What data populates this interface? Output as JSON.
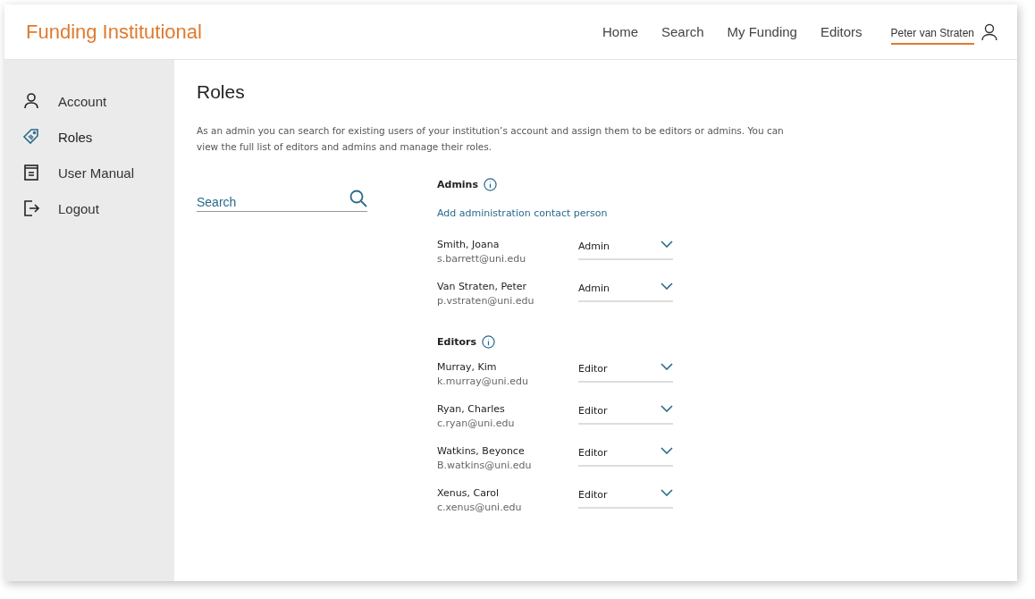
{
  "header": {
    "brand": "Funding Institutional",
    "nav": [
      "Home",
      "Search",
      "My Funding",
      "Editors"
    ],
    "user": "Peter van Straten"
  },
  "sidebar": {
    "items": [
      {
        "label": "Account",
        "kind": "person",
        "selected": false
      },
      {
        "label": "Roles",
        "kind": "tag",
        "selected": true
      },
      {
        "label": "User Manual",
        "kind": "book",
        "selected": false
      },
      {
        "label": "Logout",
        "kind": "logout",
        "selected": false
      }
    ]
  },
  "page": {
    "title": "Roles",
    "description": "As an admin you can search for existing users of your institution’s account and assign them to be editors or admins. You can view the full list of editors and admins and manage their roles.",
    "search": {
      "placeholder": "Search"
    }
  },
  "groups": [
    {
      "title": "Admins",
      "link": "Add administration contact person",
      "people": [
        {
          "name": "Smith, Joana",
          "email": "s.barrett@uni.edu",
          "role": "Admin"
        },
        {
          "name": "Van Straten, Peter",
          "email": "p.vstraten@uni.edu",
          "role": "Admin"
        }
      ]
    },
    {
      "title": "Editors",
      "people": [
        {
          "name": "Murray, Kim",
          "email": "k.murray@uni.edu",
          "role": "Editor"
        },
        {
          "name": "Ryan, Charles",
          "email": "c.ryan@uni.edu",
          "role": "Editor"
        },
        {
          "name": "Watkins, Beyonce",
          "email": "B.watkins@uni.edu",
          "role": "Editor"
        },
        {
          "name": "Xenus, Carol",
          "email": "c.xenus@uni.edu",
          "role": "Editor"
        }
      ]
    }
  ]
}
